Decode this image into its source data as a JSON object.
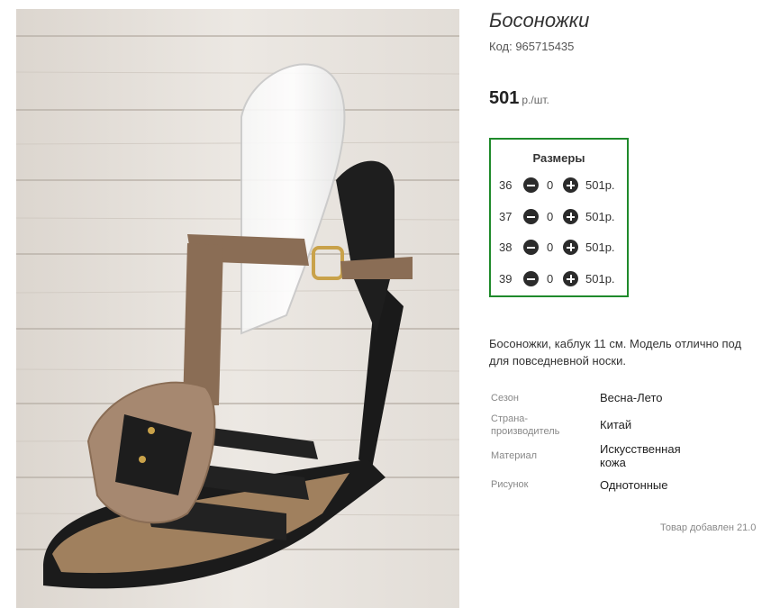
{
  "product": {
    "title": "Босоножки",
    "code": "Код: 965715435",
    "price": "501",
    "price_unit": "р./шт.",
    "image_icon": "sandal-photo"
  },
  "sizes": {
    "title": "Размеры",
    "rows": [
      {
        "size": "36",
        "qty": "0",
        "price": "501р."
      },
      {
        "size": "37",
        "qty": "0",
        "price": "501р."
      },
      {
        "size": "38",
        "qty": "0",
        "price": "501р."
      },
      {
        "size": "39",
        "qty": "0",
        "price": "501р."
      }
    ]
  },
  "description": {
    "line1": "Босоножки, каблук 11 см. Модель отлично под",
    "line2": "для повседневной носки."
  },
  "properties": [
    {
      "label": "Сезон",
      "value": "Весна-Лето"
    },
    {
      "label": "Страна-производитель",
      "label_line1": "Страна-",
      "label_line2": "производитель",
      "value": "Китай"
    },
    {
      "label": "Материал",
      "value_line1": "Искусственная",
      "value_line2": "кожа"
    },
    {
      "label": "Рисунок",
      "value": "Однотонные"
    }
  ],
  "footer": {
    "added": "Товар добавлен 21.0"
  },
  "colors": {
    "border_green": "#1f8a2b",
    "button_dark": "#2b2b2b"
  }
}
